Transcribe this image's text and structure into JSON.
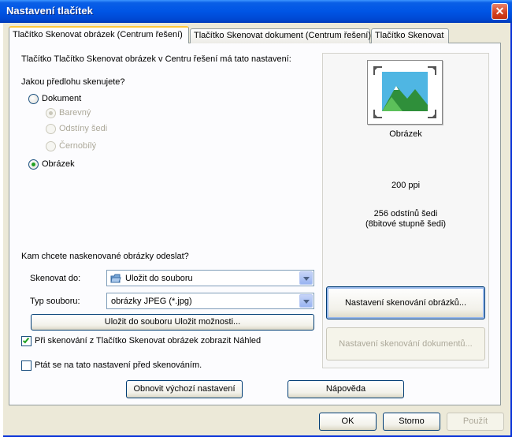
{
  "window": {
    "title": "Nastavení tlačítek",
    "close": "✕"
  },
  "tabs": [
    {
      "label": "Tlačítko Skenovat obrázek (Centrum řešení)",
      "active": true
    },
    {
      "label": "Tlačítko Skenovat dokument (Centrum řešení)",
      "active": false
    },
    {
      "label": "Tlačítko Skenovat",
      "active": false
    }
  ],
  "main": {
    "intro": "Tlačítko Tlačítko Skenovat obrázek v Centru řešení má tato nastavení:",
    "question": "Jakou předlohu skenujete?",
    "radio_document": "Dokument",
    "radio_color": "Barevný",
    "radio_gray": "Odstíny šedi",
    "radio_bw": "Černobílý",
    "radio_picture": "Obrázek",
    "destination_question": "Kam chcete naskenované obrázky odeslat?",
    "scan_to_label": "Skenovat do:",
    "scan_to_value": "Uložit do souboru",
    "file_type_label": "Typ souboru:",
    "file_type_value": "obrázky JPEG (*.jpg)",
    "save_options_button": "Uložit do souboru Uložit možnosti...",
    "show_preview_check": "Při skenování z Tlačítko Skenovat obrázek zobrazit Náhled",
    "ask_settings_check": "Ptát se na tato nastavení před skenováním.",
    "restore_defaults_button": "Obnovit výchozí nastavení",
    "help_button": "Nápověda"
  },
  "preview": {
    "type_label": "Obrázek",
    "resolution": "200 ppi",
    "color_line1": "256 odstínů šedi",
    "color_line2": "(8bitové stupně šedi)",
    "image_settings_button": "Nastavení skenování obrázků...",
    "document_settings_button": "Nastavení skenování dokumentů..."
  },
  "footer": {
    "ok": "OK",
    "cancel": "Storno",
    "apply": "Použít"
  },
  "colors": {
    "title_blue": "#0055e5",
    "tab_highlight": "#ffc83c",
    "check_green": "#21a121"
  },
  "state": {
    "radio_selected": "picture",
    "show_preview_checked": true,
    "ask_settings_checked": false
  }
}
